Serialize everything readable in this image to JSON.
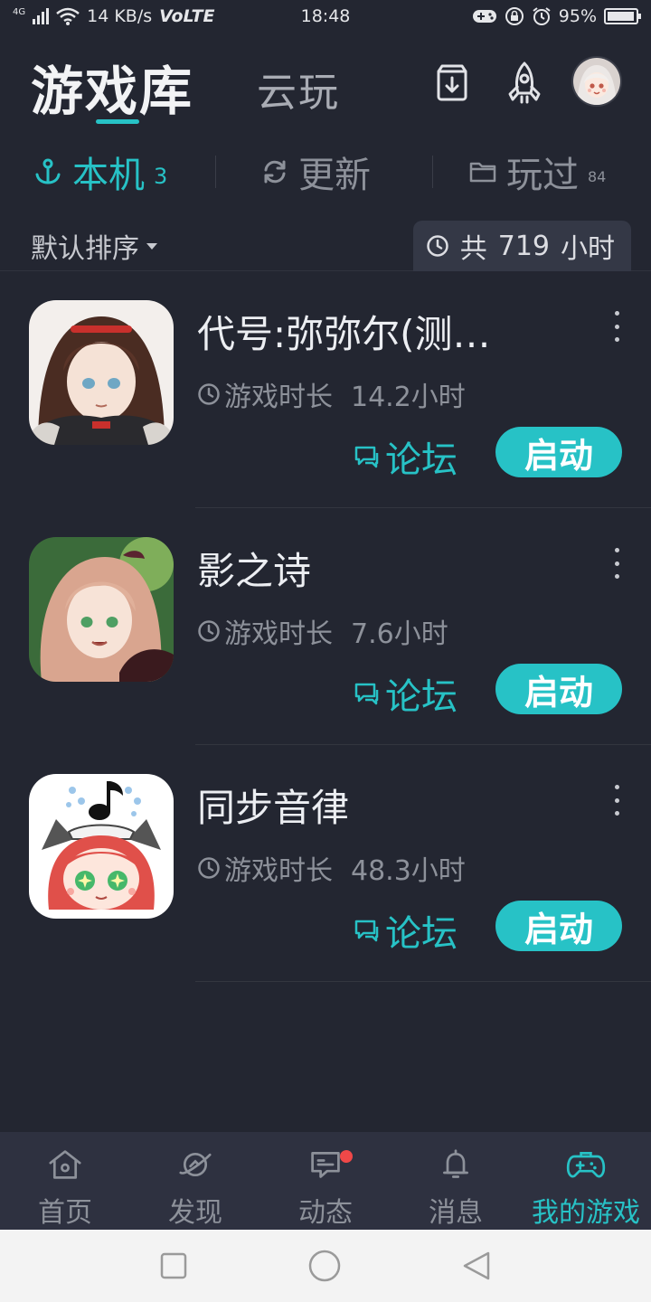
{
  "status_bar": {
    "network": "4G",
    "speed": "14 KB/s",
    "volte": "VoLTE",
    "time": "18:48",
    "battery": "95%",
    "battery_level": 0.95
  },
  "header": {
    "title": "游戏库",
    "cloud_tab": "云玩",
    "download_icon": "download-icon",
    "rocket_icon": "rocket-icon"
  },
  "filters": [
    {
      "label": "本机",
      "count": "3",
      "icon": "anchor-icon"
    },
    {
      "label": "更新",
      "count": "",
      "icon": "refresh-icon"
    },
    {
      "label": "玩过",
      "count": "84",
      "icon": "folder-icon"
    }
  ],
  "sort": {
    "label": "默认排序",
    "total_prefix": "共",
    "total_value": "719",
    "total_unit": "小时"
  },
  "games": [
    {
      "name": "代号:弥弥尔(测…",
      "time_label": "游戏时长",
      "time_value": "14.2小时",
      "forum": "论坛",
      "start": "启动"
    },
    {
      "name": "影之诗",
      "time_label": "游戏时长",
      "time_value": "7.6小时",
      "forum": "论坛",
      "start": "启动"
    },
    {
      "name": "同步音律",
      "time_label": "游戏时长",
      "time_value": "48.3小时",
      "forum": "论坛",
      "start": "启动"
    }
  ],
  "bottom_nav": [
    {
      "label": "首页",
      "icon": "home-icon"
    },
    {
      "label": "发现",
      "icon": "planet-icon"
    },
    {
      "label": "动态",
      "icon": "chat-icon"
    },
    {
      "label": "消息",
      "icon": "bell-icon"
    },
    {
      "label": "我的游戏",
      "icon": "gamepad-icon"
    }
  ],
  "colors": {
    "background": "#232631",
    "accent": "#27c2c6",
    "nav_background": "#2e3140",
    "badge": "#f04848"
  }
}
